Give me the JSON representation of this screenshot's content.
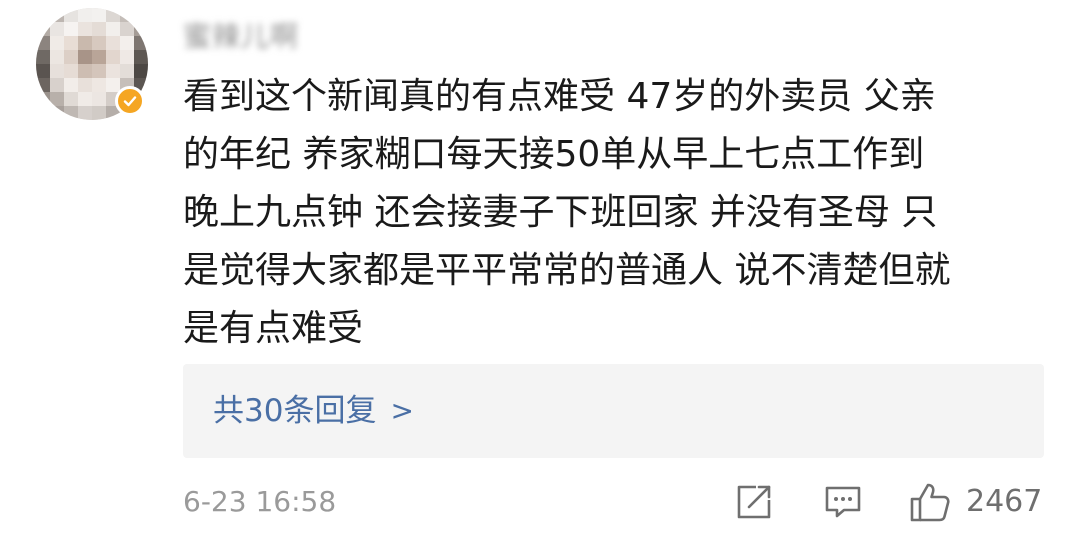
{
  "comment": {
    "username": "蜜辣儿啊",
    "verified_badge_color": "#f5a623",
    "text": "看到这个新闻真的有点难受  47岁的外卖员 父亲\n的年纪 养家糊口每天接50单从早上七点工作到\n晚上九点钟 还会接妻子下班回家  并没有圣母 只\n是觉得大家都是平平常常的普通人 说不清楚但就\n是有点难受",
    "replies_label": "共30条回复",
    "replies_arrow": ">",
    "timestamp": "6-23 16:58",
    "like_count": "2467"
  },
  "icons": {
    "share": "share-icon",
    "comment": "comment-icon",
    "like": "thumbs-up-icon",
    "verified": "verified-badge-icon"
  },
  "colors": {
    "link": "#4a6fa5",
    "muted_text": "#9a9a9a",
    "reply_box_bg": "#f4f4f4"
  }
}
